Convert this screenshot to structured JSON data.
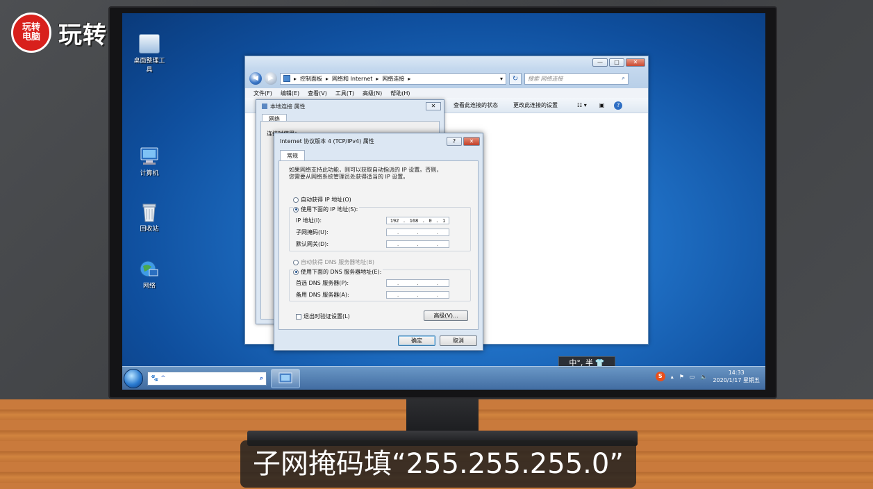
{
  "logo": {
    "seal_line1": "玩转",
    "seal_line2": "电脑",
    "brand": "玩转电脑"
  },
  "desktop": {
    "icons": [
      {
        "label": "桌面整理工具"
      },
      {
        "label": "计算机"
      },
      {
        "label": "回收站"
      },
      {
        "label": "网络"
      }
    ]
  },
  "explorer": {
    "breadcrumb": [
      "控制面板",
      "网络和 Internet",
      "网络连接"
    ],
    "search_placeholder": "搜索 网络连接",
    "menu": [
      "文件(F)",
      "编辑(E)",
      "查看(V)",
      "工具(T)",
      "高级(N)",
      "帮助(H)"
    ],
    "commands": [
      "查看此连接的状态",
      "更改此连接的设置"
    ]
  },
  "local_props": {
    "title": "本地连接 属性",
    "tab": "网络",
    "field_label": "连接时使用："
  },
  "ipv4": {
    "title": "Internet 协议版本 4 (TCP/IPv4) 属性",
    "tab": "常规",
    "intro_line1": "如果网络支持此功能，则可以获取自动指派的 IP 设置。否则，",
    "intro_line2": "您需要从网络系统管理员处获得适当的 IP 设置。",
    "radio_auto_ip": "自动获得 IP 地址(O)",
    "radio_manual_ip": "使用下面的 IP 地址(S):",
    "ip_label": "IP 地址(I):",
    "ip_value": [
      "192",
      "168",
      "0",
      "1"
    ],
    "mask_label": "子网掩码(U):",
    "gateway_label": "默认网关(D):",
    "radio_auto_dns": "自动获得 DNS 服务器地址(B)",
    "radio_manual_dns": "使用下面的 DNS 服务器地址(E):",
    "dns1_label": "首选 DNS 服务器(P):",
    "dns2_label": "备用 DNS 服务器(A):",
    "validate_label": "退出时验证设置(L)",
    "advanced_label": "高级(V)...",
    "ok_label": "确定",
    "cancel_label": "取消"
  },
  "taskbar": {
    "ime": "中°, 半",
    "time": "14:33",
    "date": "2020/1/17 星期五"
  },
  "subtitle": "子网掩码填“255.255.255.0”"
}
